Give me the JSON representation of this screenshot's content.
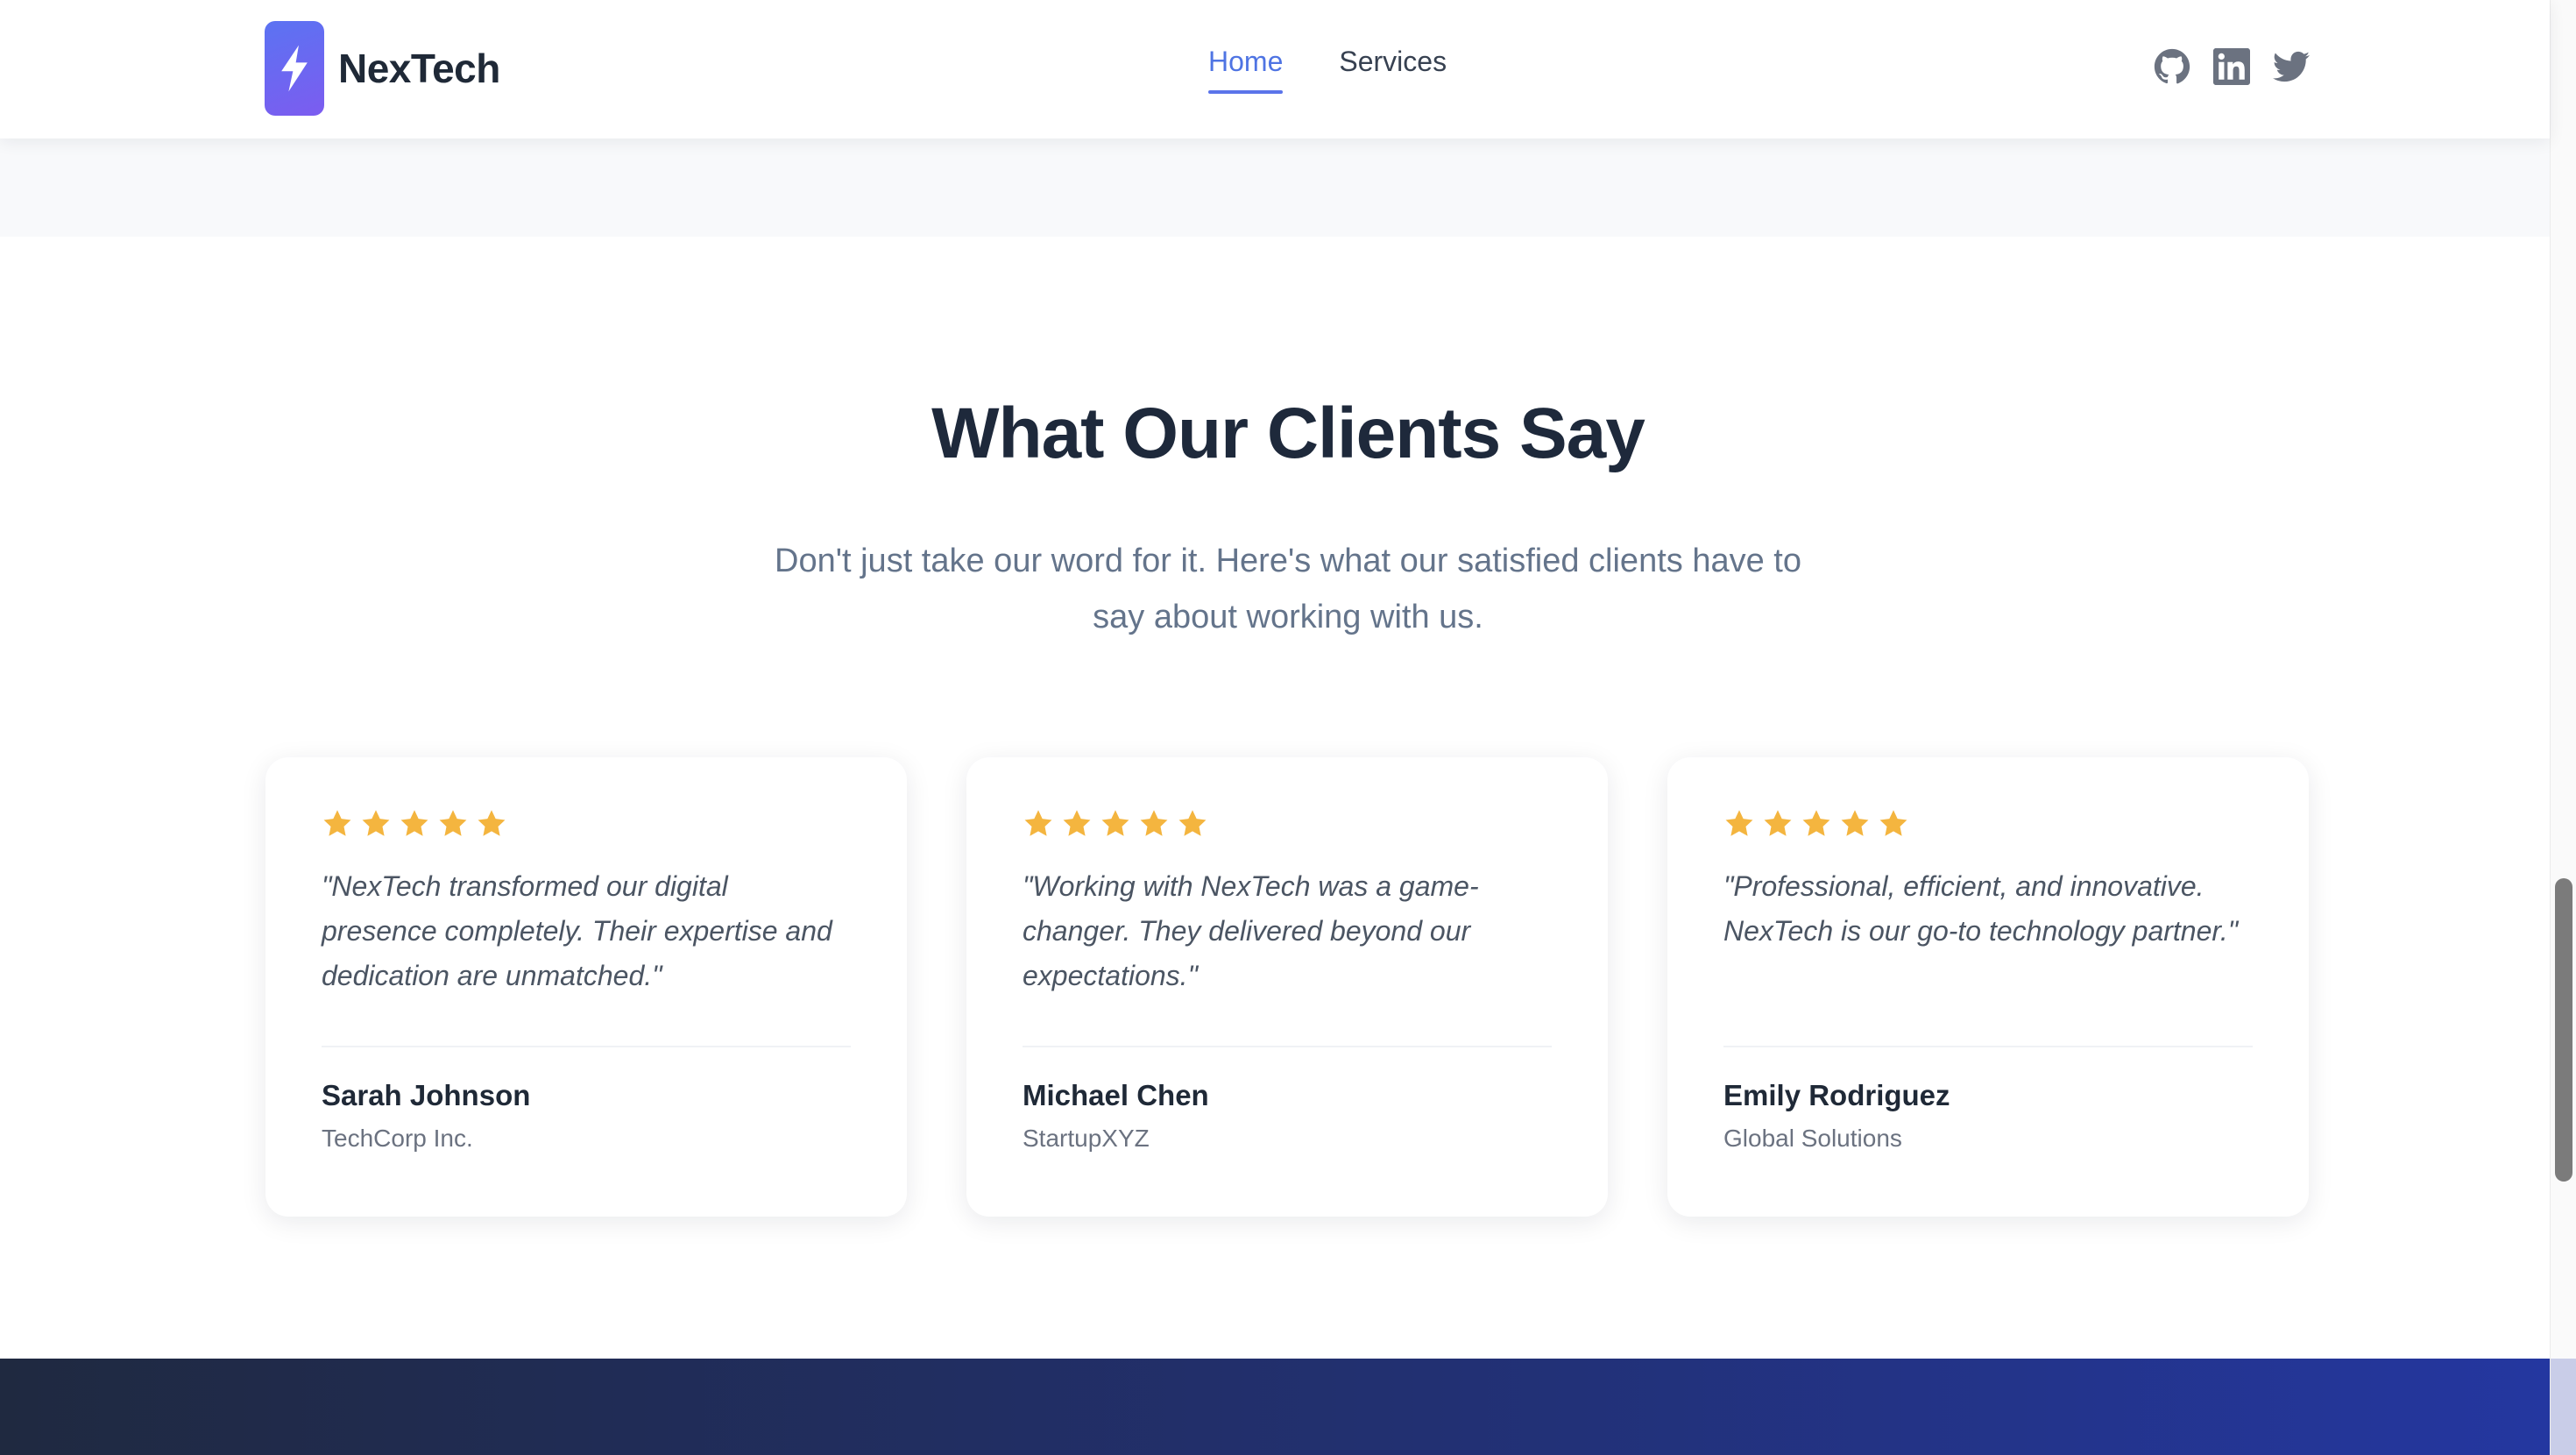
{
  "brand": {
    "name": "NexTech",
    "logo_icon": "lightning-bolt-icon"
  },
  "nav": {
    "links": [
      {
        "label": "Home",
        "active": true
      },
      {
        "label": "Services",
        "active": false
      }
    ]
  },
  "social": [
    "github-icon",
    "linkedin-icon",
    "twitter-icon"
  ],
  "testimonials": {
    "title": "What Our Clients Say",
    "subtitle": "Don't just take our word for it. Here's what our satisfied clients have to say about working with us.",
    "cards": [
      {
        "rating": 5,
        "quote": "\"NexTech transformed our digital presence completely. Their expertise and dedication are unmatched.\"",
        "name": "Sarah Johnson",
        "company": "TechCorp Inc."
      },
      {
        "rating": 5,
        "quote": "\"Working with NexTech was a game-changer. They delivered beyond our expectations.\"",
        "name": "Michael Chen",
        "company": "StartupXYZ"
      },
      {
        "rating": 5,
        "quote": "\"Professional, efficient, and innovative. NexTech is our go-to technology partner.\"",
        "name": "Emily Rodriguez",
        "company": "Global Solutions"
      }
    ]
  },
  "colors": {
    "accent": "#4f74e3",
    "star": "#f4b53f",
    "title": "#1e293b",
    "muted": "#64748b"
  }
}
